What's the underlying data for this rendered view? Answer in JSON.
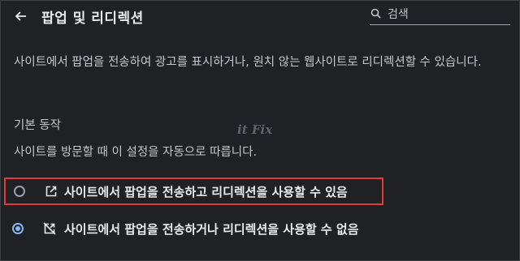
{
  "header": {
    "title": "팝업 및 리디렉션",
    "back_icon": "arrow-back-icon",
    "search": {
      "placeholder": "검색",
      "value": "",
      "icon": "search-icon"
    }
  },
  "description": "사이트에서 팝업을 전송하여 광고를 표시하거나, 원치 않는 웹사이트로 리디렉션할 수 있습니다.",
  "default_behavior": {
    "title": "기본 동작",
    "subtitle": "사이트를 방문할 때 이 설정을 자동으로 따릅니다.",
    "options": [
      {
        "label": "사이트에서 팝업을 전송하고 리디렉션을 사용할 수 있음",
        "icon": "open-in-new-icon",
        "selected": false,
        "highlighted": true
      },
      {
        "label": "사이트에서 팝업을 전송하거나 리디렉션을 사용할 수 없음",
        "icon": "open-in-new-off-icon",
        "selected": true,
        "highlighted": false
      }
    ]
  },
  "watermark": "it Fix",
  "colors": {
    "background": "#202124",
    "accent": "#8ab4f8",
    "highlight_border": "#e53935",
    "text": "#e8eaed"
  }
}
